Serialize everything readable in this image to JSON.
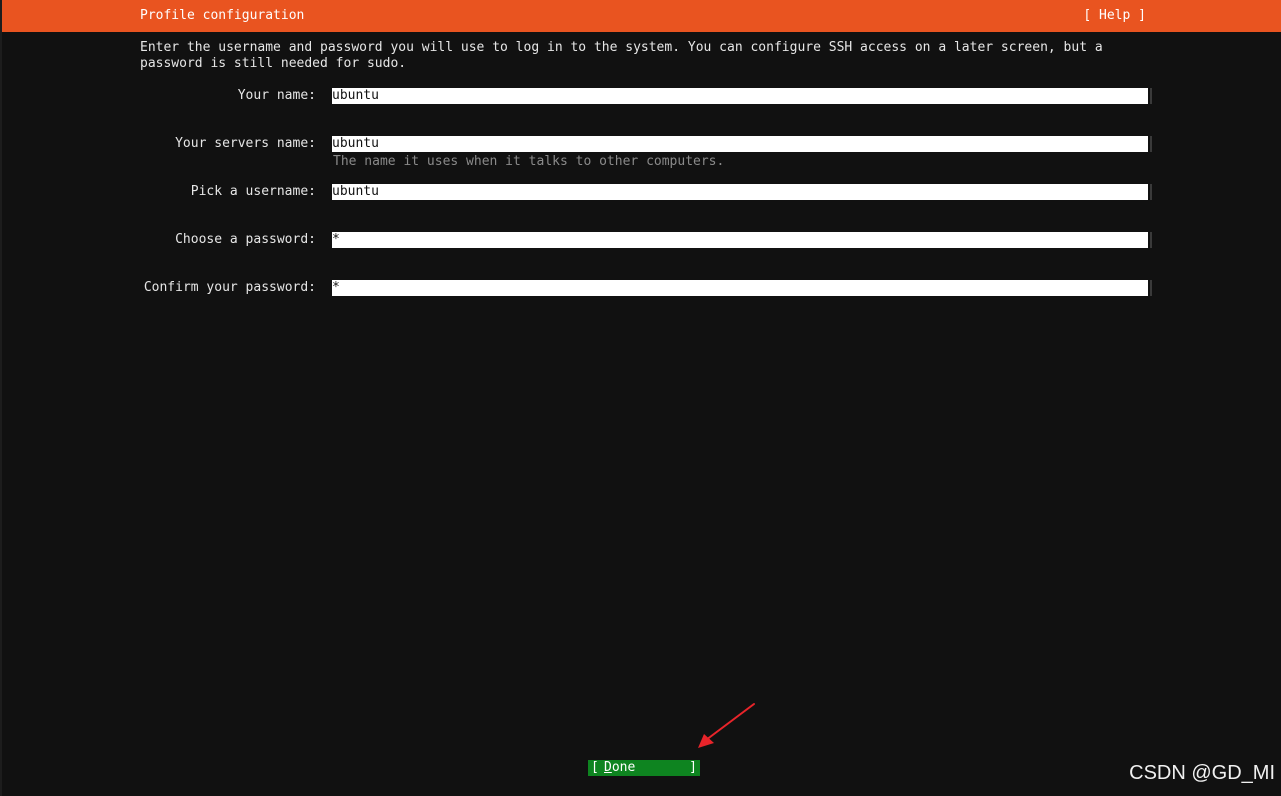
{
  "header": {
    "title": "Profile configuration",
    "help_label": "[ Help ]",
    "color": "#e95420"
  },
  "intro": {
    "line1": "Enter the username and password you will use to log in to the system. You can configure SSH access on a later screen, but a",
    "line2": "password is still needed for sudo."
  },
  "fields": [
    {
      "label": "Your name:",
      "value": "ubuntu"
    },
    {
      "label": "Your servers name:",
      "value": "ubuntu",
      "hint": "The name it uses when it talks to other computers."
    },
    {
      "label": "Pick a username:",
      "value": "ubuntu"
    },
    {
      "label": "Choose a password:",
      "value": "*"
    },
    {
      "label": "Confirm your password:",
      "value": "*"
    }
  ],
  "done_button": {
    "open": "[",
    "hotkey": "D",
    "rest": "one",
    "close": "]",
    "color": "#0e8420"
  },
  "annotation": {
    "arrow_color": "#e8242a",
    "arrow_icon": "red-arrow-icon"
  },
  "watermark": {
    "text": "CSDN @GD_MI"
  }
}
